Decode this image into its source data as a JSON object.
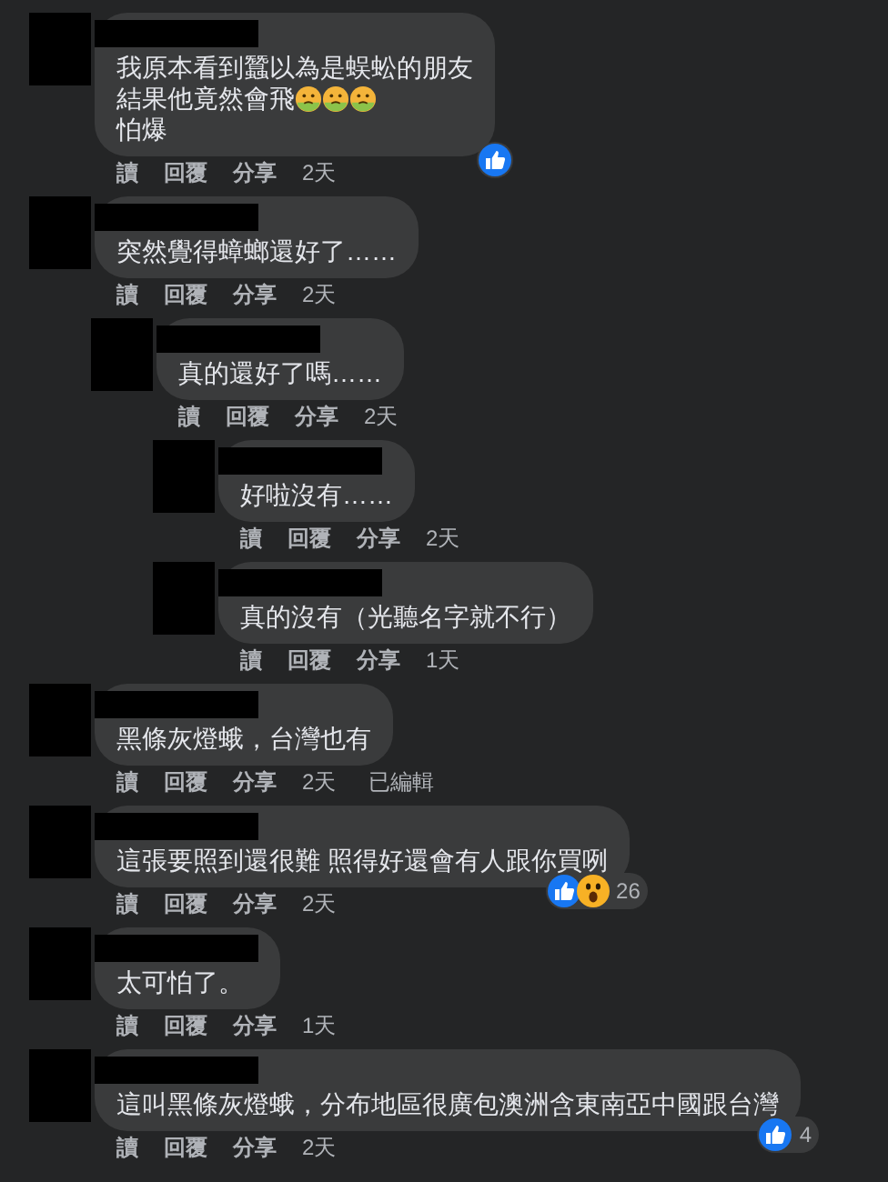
{
  "comments": [
    {
      "lines": [
        {
          "text": "我原本看到蠶以為是蜈蚣的朋友"
        },
        {
          "text": "結果他竟然會飛",
          "emojis": [
            {
              "kind": "nauseated"
            },
            {
              "kind": "nauseated"
            },
            {
              "kind": "nauseated"
            }
          ]
        },
        {
          "text": "怕爆"
        }
      ],
      "reactions": {
        "items": [
          {
            "kind": "like"
          }
        ]
      },
      "actions": [
        "讀",
        "回覆",
        "分享"
      ],
      "time": "2天"
    },
    {
      "lines": [
        {
          "text": "突然覺得蟑螂還好了……"
        }
      ],
      "actions": [
        "讀",
        "回覆",
        "分享"
      ],
      "time": "2天",
      "children": [
        {
          "lines": [
            {
              "text": "真的還好了嗎……"
            }
          ],
          "actions": [
            "讀",
            "回覆",
            "分享"
          ],
          "time": "2天",
          "children": [
            {
              "lines": [
                {
                  "text": "好啦沒有……"
                }
              ],
              "actions": [
                "讀",
                "回覆",
                "分享"
              ],
              "time": "2天"
            },
            {
              "lines": [
                {
                  "text": "真的沒有（光聽名字就不行）"
                }
              ],
              "actions": [
                "讀",
                "回覆",
                "分享"
              ],
              "time": "1天"
            }
          ]
        }
      ]
    },
    {
      "lines": [
        {
          "text": "黑條灰燈蛾，台灣也有"
        }
      ],
      "actions": [
        "讀",
        "回覆",
        "分享"
      ],
      "time": "2天",
      "edited_label": "已編輯"
    },
    {
      "lines": [
        {
          "text": "這張要照到還很難 照得好還會有人跟你買咧"
        }
      ],
      "reactions": {
        "items": [
          {
            "kind": "like"
          },
          {
            "kind": "wow"
          }
        ],
        "count": "26"
      },
      "actions": [
        "讀",
        "回覆",
        "分享"
      ],
      "time": "2天"
    },
    {
      "lines": [
        {
          "text": "太可怕了。"
        }
      ],
      "actions": [
        "讀",
        "回覆",
        "分享"
      ],
      "time": "1天"
    },
    {
      "lines": [
        {
          "text": "這叫黑條灰燈蛾，分布地區很廣包澳洲含東南亞中國跟台灣"
        }
      ],
      "reactions": {
        "items": [
          {
            "kind": "like"
          }
        ],
        "count": "4"
      },
      "actions": [
        "讀",
        "回覆",
        "分享"
      ],
      "time": "2天"
    }
  ]
}
